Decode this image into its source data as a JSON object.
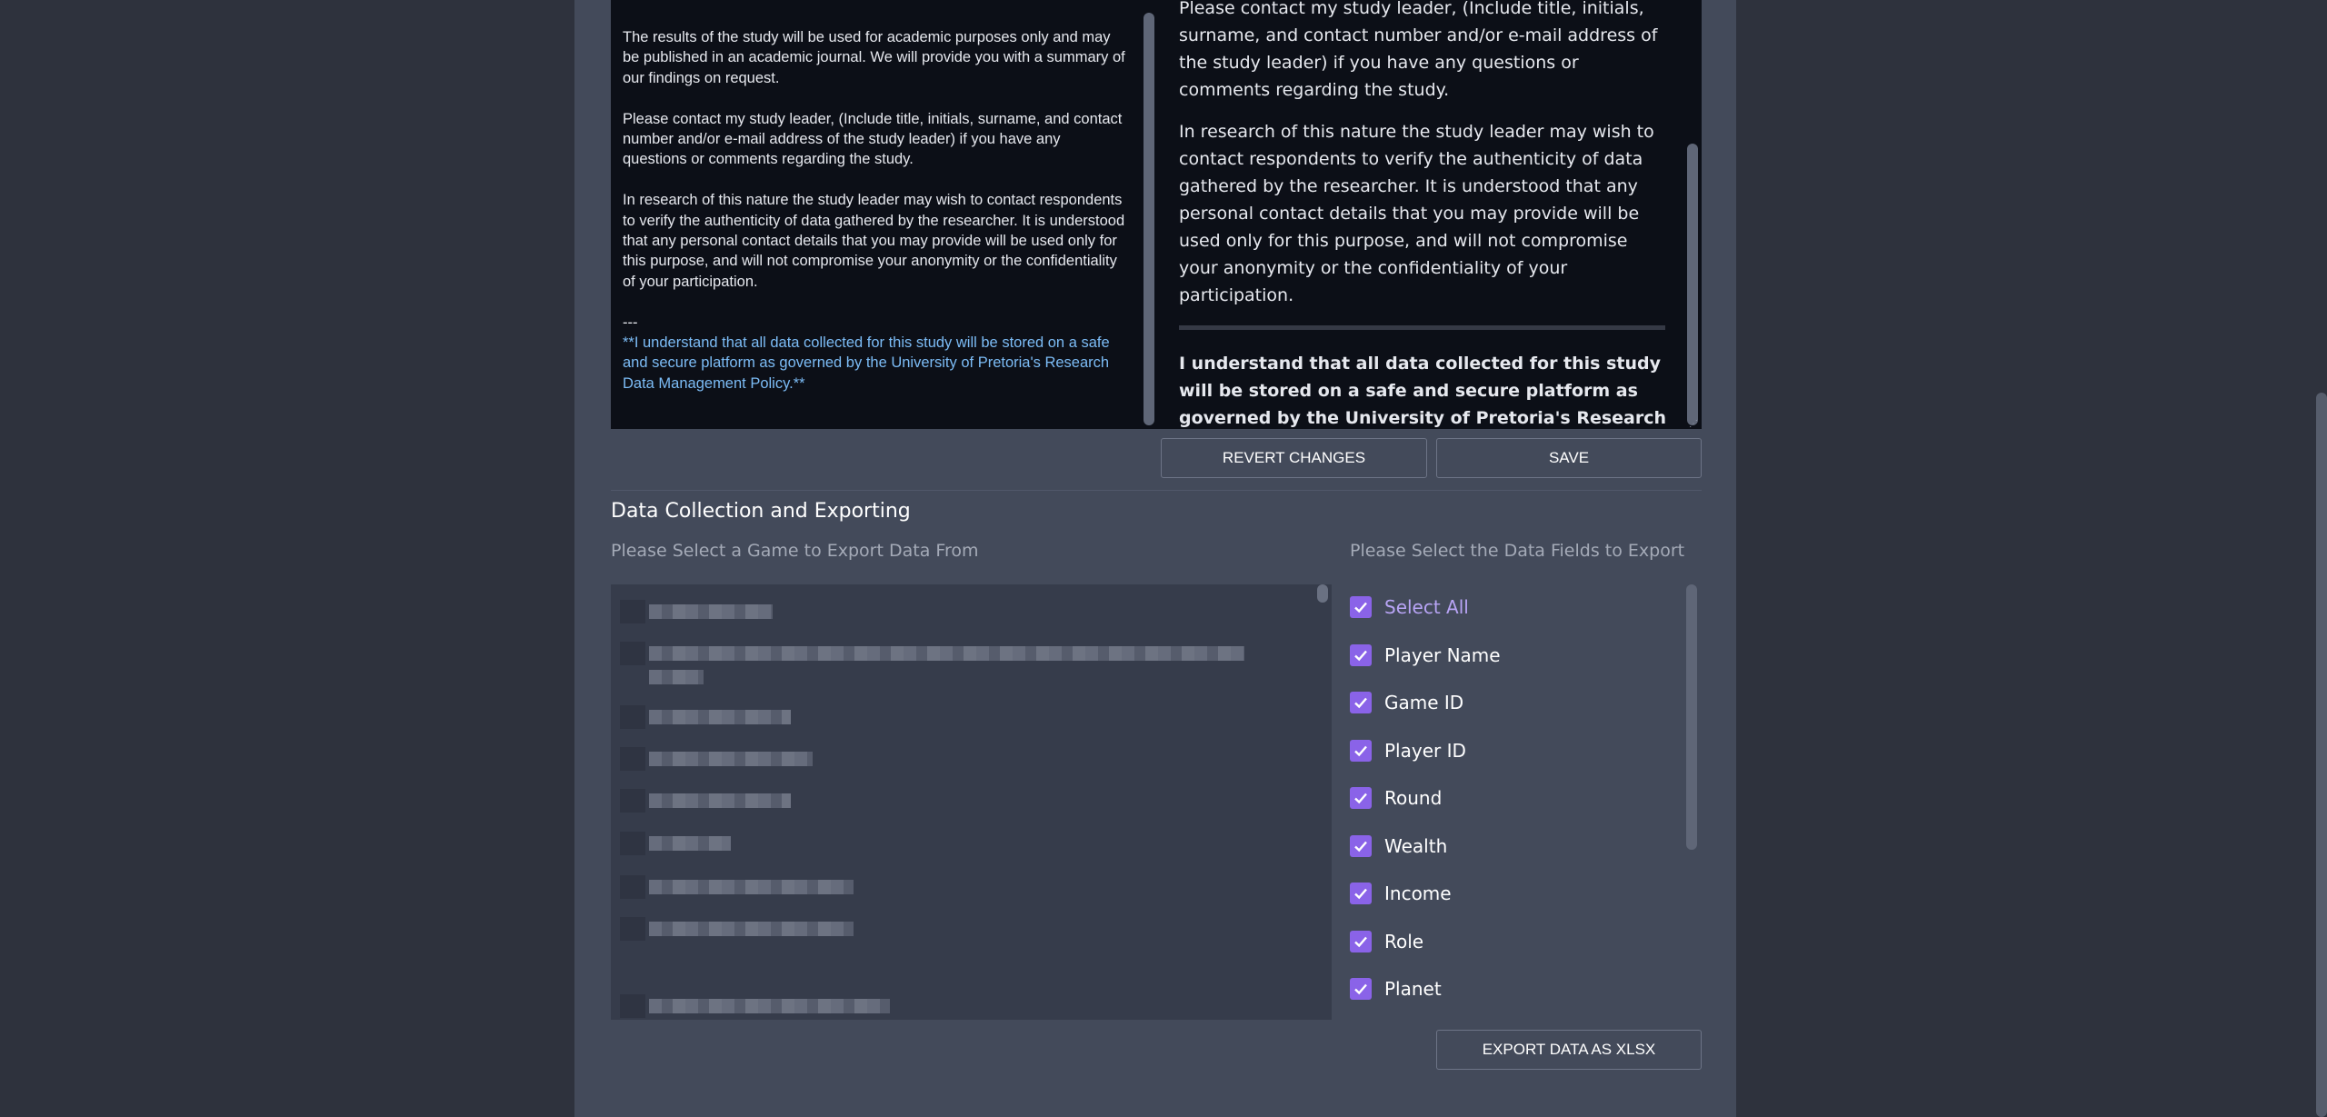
{
  "editor": {
    "para1": "The results of the study will be used for academic purposes only  and may be published in an academic journal. We will provide you with a summary of our findings on request.",
    "para2": "Please contact my study leader, (Include title, initials, surname, and contact number and/or e-mail  address of the study leader) if you have any questions or comments regarding the study.",
    "para3": "In research of this nature the study leader may wish to contact respondents to verify the authenticity of data gathered by the researcher.  It is understood that any personal contact details that you may provide will be used only for this purpose, and will not compromise your anonymity or the confidentiality of your participation.",
    "separator": "---",
    "bold_para": "**I understand that all data collected for this study will be stored on a safe and secure platform as governed by the University of Pretoria's Research Data Management  Policy.**"
  },
  "preview": {
    "para1": "Please contact my study leader, (Include title, initials, surname, and contact number and/or e-mail address of the study leader) if you have any questions or comments regarding the study.",
    "para2": "In research of this nature the study leader may wish to contact respondents to verify the authenticity of data gathered by the researcher.  It is understood that any personal contact details that you may provide will be used only for this purpose, and will not compromise your anonymity or the confidentiality of your participation.",
    "bold_para": "I understand that all data collected for this study will be stored on a safe and secure platform as governed by the University of Pretoria's Research Data Management Policy."
  },
  "buttons": {
    "revert": "REVERT CHANGES",
    "save": "SAVE",
    "export": "EXPORT DATA AS XLSX"
  },
  "data_section": {
    "title": "Data Collection and Exporting",
    "game_label": "Please Select a Game to Export Data From",
    "fields_label": "Please Select the Data Fields to Export"
  },
  "fields": [
    {
      "label": "Select All",
      "checked": true
    },
    {
      "label": "Player Name",
      "checked": true
    },
    {
      "label": "Game ID",
      "checked": true
    },
    {
      "label": "Player ID",
      "checked": true
    },
    {
      "label": "Round",
      "checked": true
    },
    {
      "label": "Wealth",
      "checked": true
    },
    {
      "label": "Income",
      "checked": true
    },
    {
      "label": "Role",
      "checked": true
    },
    {
      "label": "Planet",
      "checked": true
    }
  ],
  "colors": {
    "checkbox": "#8a63e8",
    "link_text": "#7cbcf6",
    "panel": "#434a5a"
  }
}
